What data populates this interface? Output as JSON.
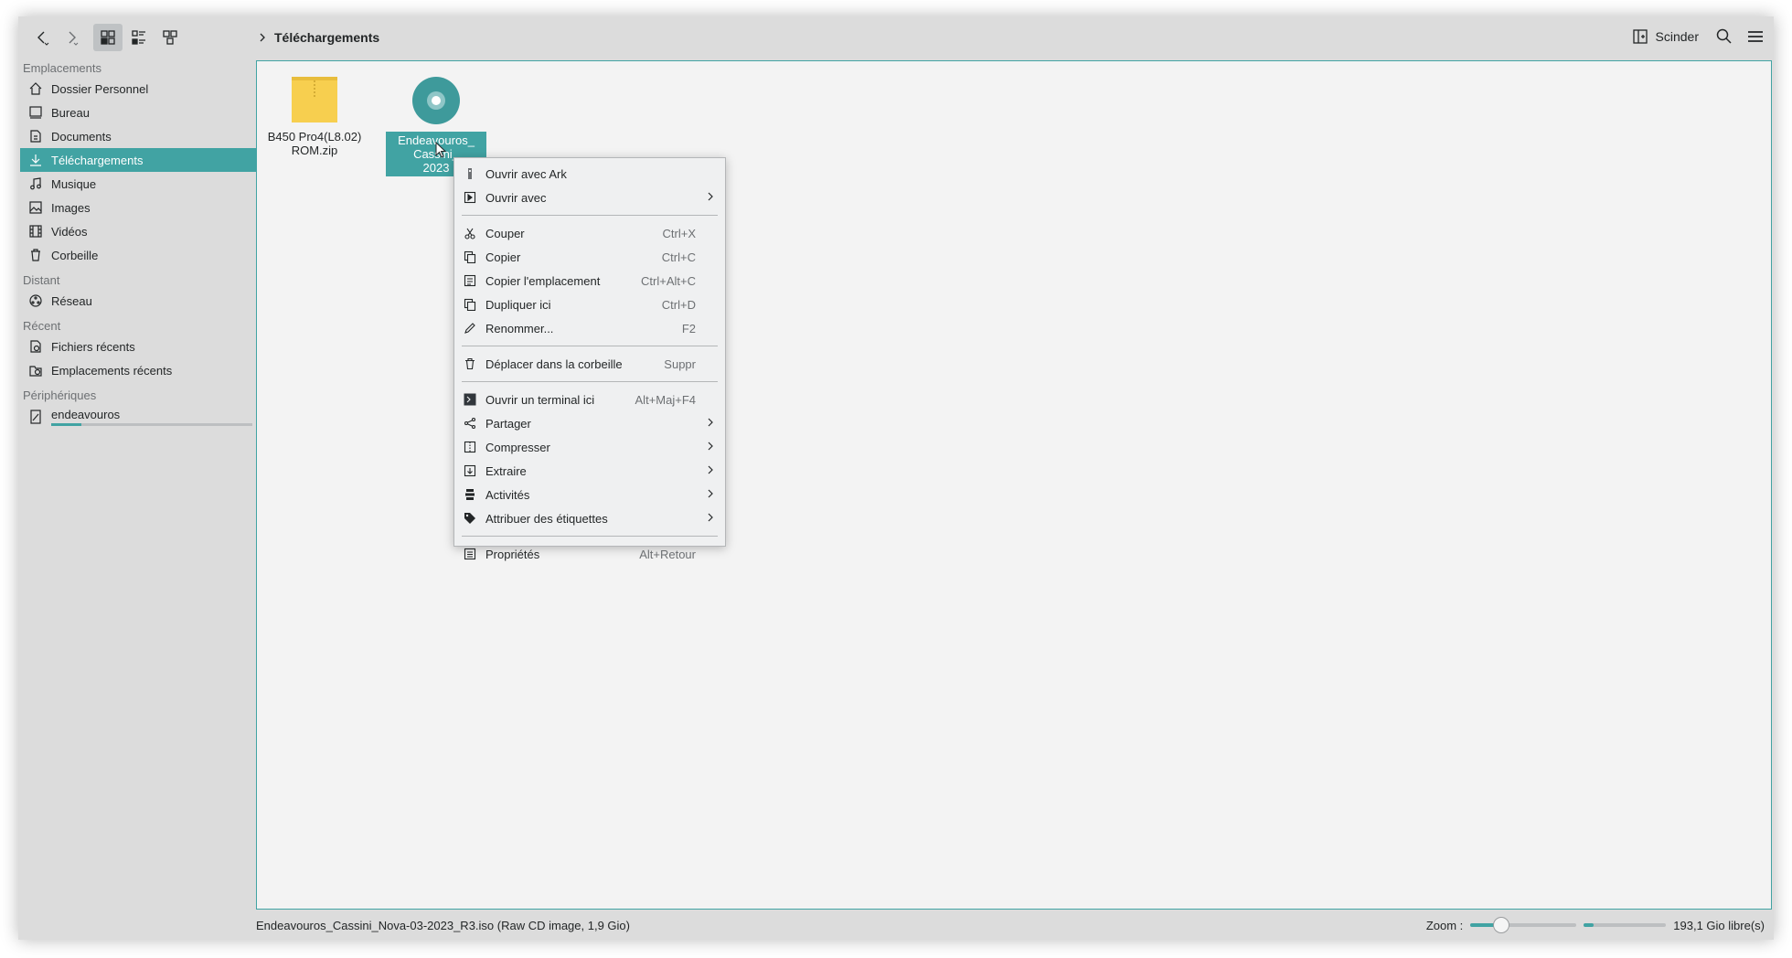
{
  "toolbar": {
    "breadcrumb": "Téléchargements",
    "split_label": "Scinder"
  },
  "sidebar": {
    "sections": [
      {
        "title": "Emplacements",
        "items": [
          {
            "label": "Dossier Personnel",
            "icon": "home-icon"
          },
          {
            "label": "Bureau",
            "icon": "desktop-icon"
          },
          {
            "label": "Documents",
            "icon": "documents-icon"
          },
          {
            "label": "Téléchargements",
            "icon": "download-icon",
            "active": true
          },
          {
            "label": "Musique",
            "icon": "music-icon"
          },
          {
            "label": "Images",
            "icon": "images-icon"
          },
          {
            "label": "Vidéos",
            "icon": "videos-icon"
          },
          {
            "label": "Corbeille",
            "icon": "trash-icon"
          }
        ]
      },
      {
        "title": "Distant",
        "items": [
          {
            "label": "Réseau",
            "icon": "network-icon"
          }
        ]
      },
      {
        "title": "Récent",
        "items": [
          {
            "label": "Fichiers récents",
            "icon": "recent-files-icon"
          },
          {
            "label": "Emplacements récents",
            "icon": "recent-locations-icon"
          }
        ]
      },
      {
        "title": "Périphériques",
        "items": [
          {
            "label": "endeavouros",
            "icon": "drive-icon",
            "usage_fraction": 0.15
          }
        ]
      }
    ]
  },
  "files": [
    {
      "name": "B450 Pro4(L8.02) ROM.zip",
      "line1": "B450 Pro4(L8.02)",
      "line2": "ROM.zip",
      "icon": "zip-archive-icon"
    },
    {
      "name": "Endeavouros_Cassini_Nova-03-2023_R3.iso",
      "line1": "Endeavouros_",
      "line2": "Cassini_",
      "line3": "2023",
      "icon": "disc-image-icon",
      "selected": true
    }
  ],
  "context_menu": {
    "items": [
      {
        "label": "Ouvrir avec Ark",
        "shortcut": "",
        "icon": "ark-icon"
      },
      {
        "label": "Ouvrir avec",
        "shortcut": "",
        "icon": "open-with-icon",
        "submenu": true
      },
      {
        "separator": true
      },
      {
        "label": "Couper",
        "shortcut": "Ctrl+X",
        "icon": "cut-icon"
      },
      {
        "label": "Copier",
        "shortcut": "Ctrl+C",
        "icon": "copy-icon"
      },
      {
        "label": "Copier l'emplacement",
        "shortcut": "Ctrl+Alt+C",
        "icon": "copy-location-icon"
      },
      {
        "label": "Dupliquer ici",
        "shortcut": "Ctrl+D",
        "icon": "duplicate-icon"
      },
      {
        "label": "Renommer...",
        "shortcut": "F2",
        "icon": "rename-icon"
      },
      {
        "separator": true
      },
      {
        "label": "Déplacer dans la corbeille",
        "shortcut": "Suppr",
        "icon": "trash-icon"
      },
      {
        "separator": true
      },
      {
        "label": "Ouvrir un terminal ici",
        "shortcut": "Alt+Maj+F4",
        "icon": "terminal-icon"
      },
      {
        "label": "Partager",
        "shortcut": "",
        "icon": "share-icon",
        "submenu": true
      },
      {
        "label": "Compresser",
        "shortcut": "",
        "icon": "compress-icon",
        "submenu": true
      },
      {
        "label": "Extraire",
        "shortcut": "",
        "icon": "extract-icon",
        "submenu": true
      },
      {
        "label": "Activités",
        "shortcut": "",
        "icon": "activities-icon",
        "submenu": true
      },
      {
        "label": "Attribuer des étiquettes",
        "shortcut": "",
        "icon": "tag-icon",
        "submenu": true
      },
      {
        "separator": true
      },
      {
        "label": "Propriétés",
        "shortcut": "Alt+Retour",
        "icon": "properties-icon"
      }
    ]
  },
  "statusbar": {
    "text": "Endeavouros_Cassini_Nova-03-2023_R3.iso (Raw CD image, 1,9 Gio)",
    "zoom_label": "Zoom :",
    "zoom_fraction": 0.28,
    "free_space": "193,1 Gio libre(s)",
    "disk_used_fraction": 0.12
  },
  "colors": {
    "accent": "#41a3a3",
    "window_bg": "#dcdcdc",
    "view_bg": "#f3f3f3",
    "menu_bg": "#eff0f1"
  }
}
